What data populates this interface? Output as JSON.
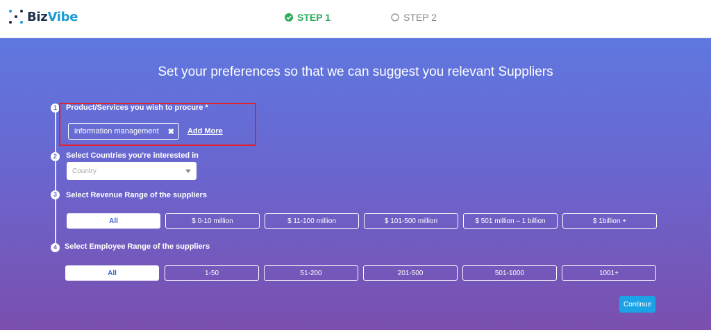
{
  "brand": {
    "name_part1": "Biz",
    "name_part2": "Vibe"
  },
  "steps": [
    {
      "label": "STEP 1",
      "state": "completed",
      "icon": "check-circle-icon",
      "color": "#2dab5b"
    },
    {
      "label": "STEP 2",
      "state": "pending",
      "icon": "empty-circle-icon",
      "color": "#8a8a8a"
    }
  ],
  "headline": "Set your preferences so that we can suggest you relevant Suppliers",
  "q1": {
    "number": "1",
    "label": "Product/Services you wish to procure *",
    "tag": "information management",
    "remove_icon": "close-icon",
    "add_more": "Add More"
  },
  "q2": {
    "number": "2",
    "label": "Select Countries you're interested in",
    "placeholder": "Country"
  },
  "q3": {
    "number": "3",
    "label": "Select Revenue Range of the suppliers",
    "options": [
      "All",
      "$ 0-10 million",
      "$ 11-100 million",
      "$ 101-500 million",
      "$ 501 million – 1 billion",
      "$ 1billion +"
    ],
    "selected": "All"
  },
  "q4": {
    "number": "4",
    "label": "Select Employee Range of the suppliers",
    "options": [
      "All",
      "1-50",
      "51-200",
      "201-500",
      "501-1000",
      "1001+"
    ],
    "selected": "All"
  },
  "continue_label": "Continue",
  "colors": {
    "accent": "#1ba3e5",
    "highlight": "#e0222d",
    "gradient_top": "#5f78e0",
    "gradient_bottom": "#7a4fae"
  }
}
